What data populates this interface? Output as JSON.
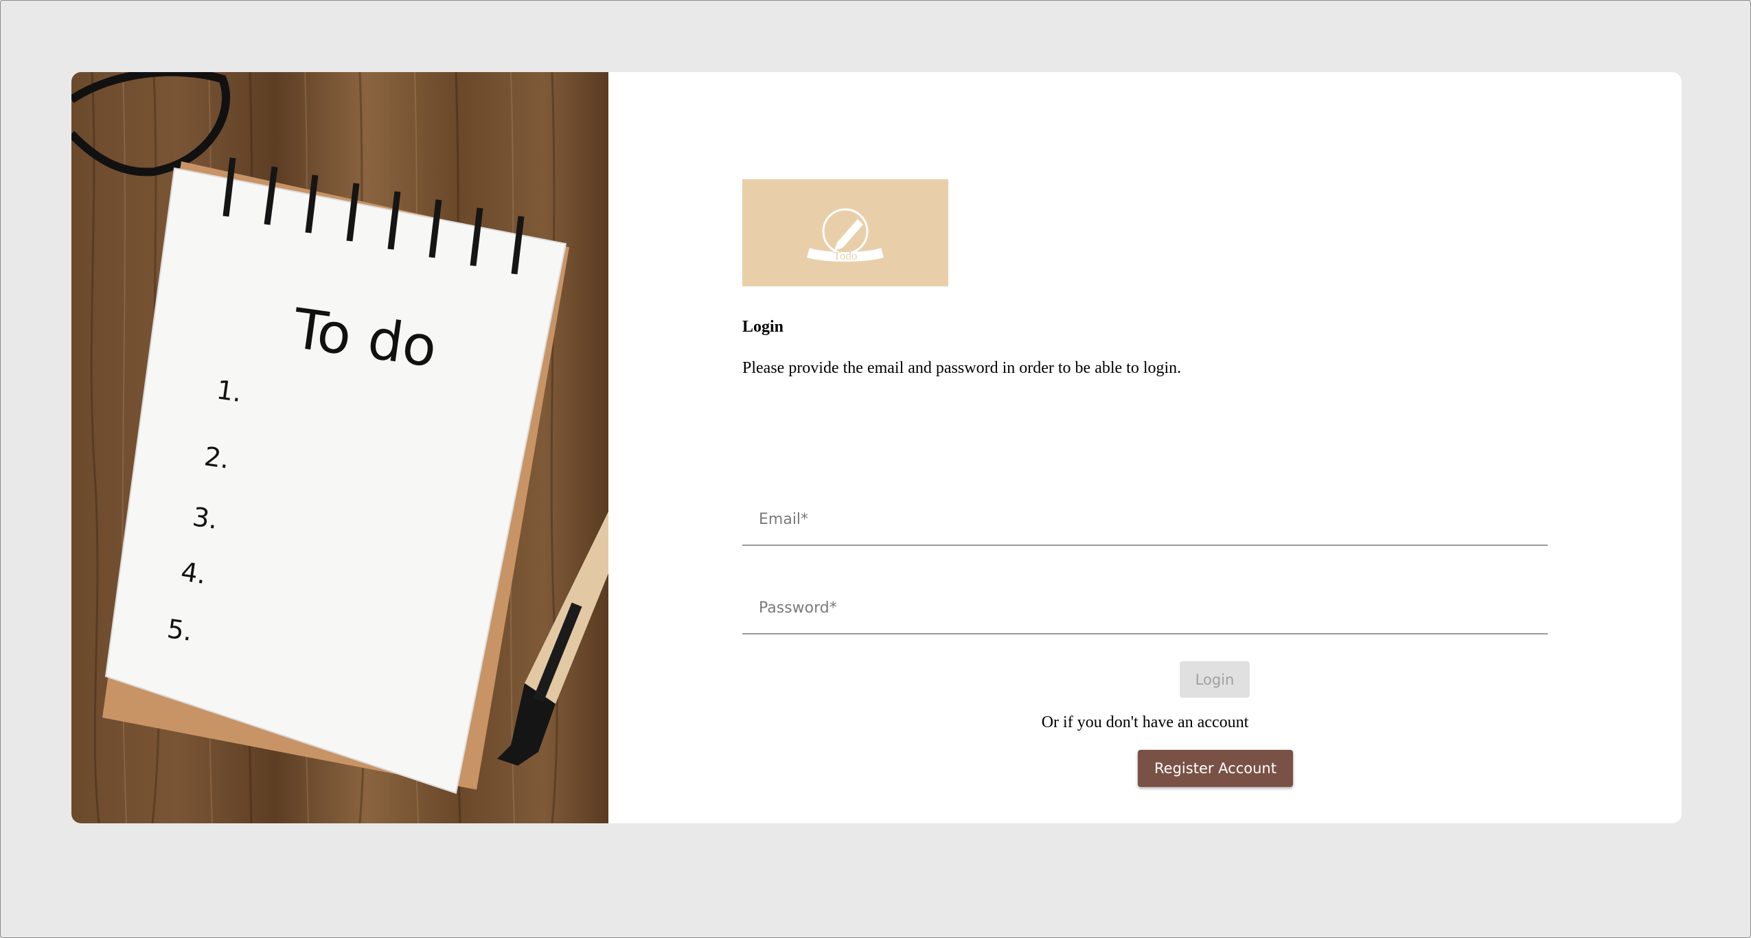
{
  "illustration": {
    "heading": "To do",
    "list_numbers": [
      "1.",
      "2.",
      "3.",
      "4.",
      "5."
    ]
  },
  "logo": {
    "label": "Todo",
    "icon": "pencil-icon",
    "background_color": "#e9cfa9"
  },
  "login": {
    "title": "Login",
    "subtitle": "Please provide the email and password in order to be able to login.",
    "email_placeholder": "Email*",
    "email_value": "",
    "password_placeholder": "Password*",
    "password_value": "",
    "login_label": "Login",
    "alt_text": "Or if you don't have an account",
    "register_label": "Register Account"
  },
  "colors": {
    "page_background": "#e9e9e9",
    "register_button": "#7a5245",
    "login_button_disabled": "#e0e0e0"
  }
}
